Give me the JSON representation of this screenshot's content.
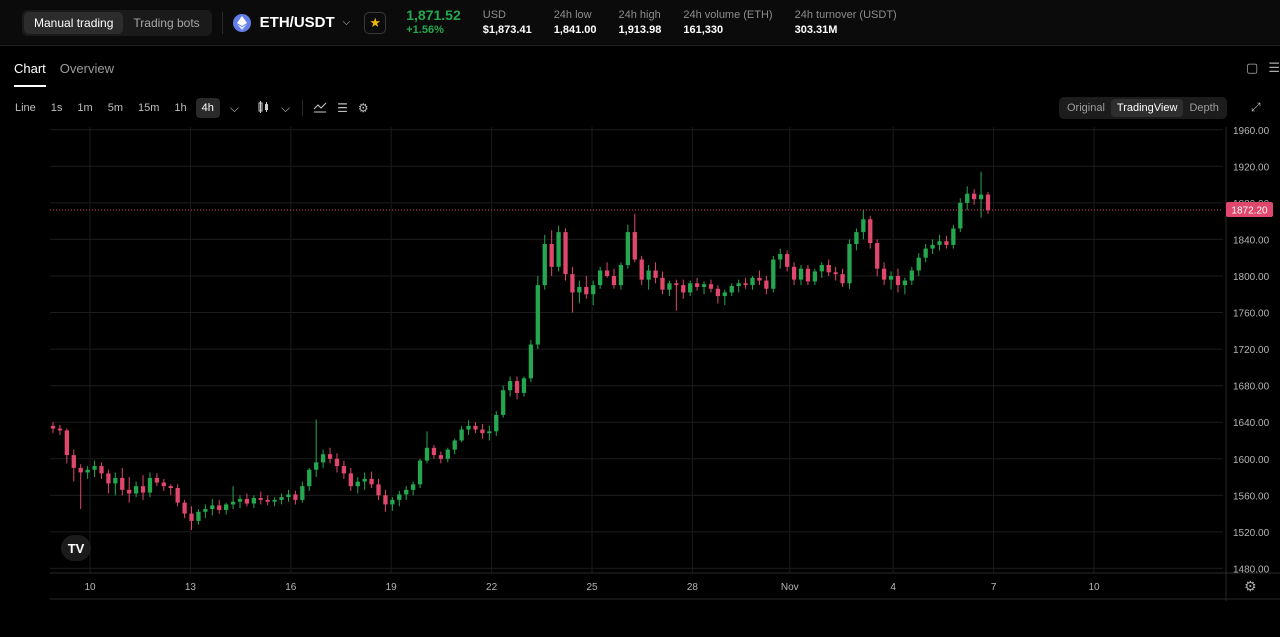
{
  "header": {
    "modes": [
      "Manual trading",
      "Trading bots"
    ],
    "pair": "ETH/USDT",
    "last_price": "1,871.52",
    "change": "+1.56%",
    "stats": [
      {
        "label": "USD",
        "value": "$1,873.41"
      },
      {
        "label": "24h low",
        "value": "1,841.00"
      },
      {
        "label": "24h high",
        "value": "1,913.98"
      },
      {
        "label": "24h volume (ETH)",
        "value": "161,330"
      },
      {
        "label": "24h turnover (USDT)",
        "value": "303.31M"
      }
    ]
  },
  "tabs": [
    "Chart",
    "Overview"
  ],
  "toolbar": {
    "timeframes": [
      "Line",
      "1s",
      "1m",
      "5m",
      "15m",
      "1h",
      "4h"
    ],
    "active_timeframe": "4h",
    "views": [
      "Original",
      "TradingView",
      "Depth"
    ],
    "active_view": "TradingView"
  },
  "colors": {
    "up": "#25a750",
    "down": "#e0476c",
    "price_line": "#e0476c"
  },
  "icons": [
    "ethereum-icon",
    "chevron-down-icon",
    "star-icon",
    "candles-icon",
    "indicator-icon",
    "layout-icon",
    "gear-icon",
    "expand-icon",
    "tradingview-logo"
  ],
  "chart_data": {
    "type": "candlestick",
    "y_ticks": [
      "1960.00",
      "1920.00",
      "1880.00",
      "1840.00",
      "1800.00",
      "1760.00",
      "1720.00",
      "1680.00",
      "1640.00",
      "1600.00",
      "1560.00",
      "1520.00",
      "1480.00"
    ],
    "x_ticks": [
      "10",
      "13",
      "16",
      "19",
      "22",
      "25",
      "28",
      "Nov",
      "4",
      "7",
      "10"
    ],
    "current_price_label": "1872.20",
    "current_price": 1872.2,
    "ylim": [
      1475,
      1963
    ],
    "grid": true,
    "series_ohlc": [
      [
        1636,
        1640,
        1628,
        1633
      ],
      [
        1633,
        1637,
        1626,
        1631
      ],
      [
        1631,
        1633,
        1595,
        1604
      ],
      [
        1604,
        1610,
        1575,
        1590
      ],
      [
        1590,
        1594,
        1545,
        1585
      ],
      [
        1585,
        1592,
        1578,
        1588
      ],
      [
        1588,
        1598,
        1580,
        1592
      ],
      [
        1592,
        1596,
        1578,
        1584
      ],
      [
        1584,
        1588,
        1562,
        1573
      ],
      [
        1573,
        1585,
        1560,
        1579
      ],
      [
        1579,
        1590,
        1560,
        1566
      ],
      [
        1566,
        1580,
        1552,
        1562
      ],
      [
        1562,
        1575,
        1558,
        1570
      ],
      [
        1570,
        1582,
        1555,
        1563
      ],
      [
        1563,
        1585,
        1558,
        1579
      ],
      [
        1579,
        1584,
        1570,
        1574
      ],
      [
        1574,
        1578,
        1565,
        1570
      ],
      [
        1570,
        1572,
        1560,
        1568
      ],
      [
        1568,
        1572,
        1548,
        1552
      ],
      [
        1552,
        1555,
        1535,
        1540
      ],
      [
        1540,
        1548,
        1522,
        1532
      ],
      [
        1532,
        1545,
        1528,
        1542
      ],
      [
        1542,
        1550,
        1535,
        1545
      ],
      [
        1545,
        1556,
        1538,
        1549
      ],
      [
        1549,
        1555,
        1540,
        1544
      ],
      [
        1544,
        1552,
        1539,
        1550
      ],
      [
        1550,
        1570,
        1545,
        1553
      ],
      [
        1553,
        1560,
        1546,
        1556
      ],
      [
        1556,
        1562,
        1548,
        1551
      ],
      [
        1551,
        1560,
        1546,
        1557
      ],
      [
        1557,
        1564,
        1550,
        1555
      ],
      [
        1555,
        1560,
        1549,
        1553
      ],
      [
        1553,
        1558,
        1548,
        1555
      ],
      [
        1555,
        1562,
        1550,
        1558
      ],
      [
        1558,
        1566,
        1553,
        1561
      ],
      [
        1561,
        1565,
        1550,
        1555
      ],
      [
        1555,
        1575,
        1552,
        1570
      ],
      [
        1570,
        1590,
        1565,
        1588
      ],
      [
        1588,
        1643,
        1580,
        1596
      ],
      [
        1596,
        1610,
        1590,
        1605
      ],
      [
        1605,
        1612,
        1595,
        1600
      ],
      [
        1600,
        1606,
        1585,
        1592
      ],
      [
        1592,
        1598,
        1578,
        1584
      ],
      [
        1584,
        1590,
        1565,
        1570
      ],
      [
        1570,
        1580,
        1562,
        1575
      ],
      [
        1575,
        1585,
        1566,
        1578
      ],
      [
        1578,
        1586,
        1568,
        1572
      ],
      [
        1572,
        1578,
        1555,
        1560
      ],
      [
        1560,
        1566,
        1542,
        1550
      ],
      [
        1550,
        1558,
        1543,
        1555
      ],
      [
        1555,
        1565,
        1548,
        1561
      ],
      [
        1561,
        1570,
        1555,
        1566
      ],
      [
        1566,
        1575,
        1560,
        1572
      ],
      [
        1572,
        1600,
        1568,
        1598
      ],
      [
        1598,
        1630,
        1595,
        1612
      ],
      [
        1612,
        1615,
        1600,
        1604
      ],
      [
        1604,
        1608,
        1595,
        1600
      ],
      [
        1600,
        1612,
        1596,
        1610
      ],
      [
        1610,
        1622,
        1605,
        1620
      ],
      [
        1620,
        1636,
        1618,
        1632
      ],
      [
        1632,
        1642,
        1626,
        1636
      ],
      [
        1636,
        1640,
        1628,
        1632
      ],
      [
        1632,
        1638,
        1622,
        1628
      ],
      [
        1628,
        1636,
        1620,
        1630
      ],
      [
        1630,
        1652,
        1625,
        1648
      ],
      [
        1648,
        1680,
        1645,
        1675
      ],
      [
        1675,
        1690,
        1668,
        1685
      ],
      [
        1685,
        1690,
        1665,
        1672
      ],
      [
        1672,
        1690,
        1668,
        1688
      ],
      [
        1688,
        1730,
        1684,
        1725
      ],
      [
        1725,
        1800,
        1720,
        1790
      ],
      [
        1790,
        1845,
        1785,
        1835
      ],
      [
        1835,
        1850,
        1800,
        1810
      ],
      [
        1810,
        1855,
        1805,
        1848
      ],
      [
        1848,
        1852,
        1795,
        1802
      ],
      [
        1802,
        1810,
        1760,
        1782
      ],
      [
        1782,
        1795,
        1770,
        1788
      ],
      [
        1788,
        1800,
        1775,
        1780
      ],
      [
        1780,
        1795,
        1768,
        1790
      ],
      [
        1790,
        1810,
        1786,
        1806
      ],
      [
        1806,
        1815,
        1798,
        1800
      ],
      [
        1800,
        1808,
        1786,
        1790
      ],
      [
        1790,
        1815,
        1785,
        1812
      ],
      [
        1812,
        1856,
        1808,
        1848
      ],
      [
        1848,
        1868,
        1815,
        1818
      ],
      [
        1818,
        1822,
        1790,
        1796
      ],
      [
        1796,
        1812,
        1785,
        1806
      ],
      [
        1806,
        1815,
        1792,
        1798
      ],
      [
        1798,
        1805,
        1780,
        1785
      ],
      [
        1785,
        1795,
        1778,
        1792
      ],
      [
        1792,
        1796,
        1762,
        1790
      ],
      [
        1790,
        1796,
        1775,
        1782
      ],
      [
        1782,
        1795,
        1778,
        1792
      ],
      [
        1792,
        1798,
        1784,
        1788
      ],
      [
        1788,
        1794,
        1780,
        1791
      ],
      [
        1791,
        1796,
        1782,
        1786
      ],
      [
        1786,
        1790,
        1770,
        1778
      ],
      [
        1778,
        1785,
        1768,
        1782
      ],
      [
        1782,
        1792,
        1778,
        1789
      ],
      [
        1789,
        1796,
        1782,
        1792
      ],
      [
        1792,
        1798,
        1786,
        1790
      ],
      [
        1790,
        1800,
        1785,
        1798
      ],
      [
        1798,
        1806,
        1790,
        1795
      ],
      [
        1795,
        1800,
        1780,
        1786
      ],
      [
        1786,
        1822,
        1782,
        1818
      ],
      [
        1818,
        1830,
        1808,
        1824
      ],
      [
        1824,
        1828,
        1805,
        1810
      ],
      [
        1810,
        1815,
        1790,
        1796
      ],
      [
        1796,
        1812,
        1790,
        1808
      ],
      [
        1808,
        1812,
        1790,
        1794
      ],
      [
        1794,
        1808,
        1790,
        1805
      ],
      [
        1805,
        1815,
        1798,
        1812
      ],
      [
        1812,
        1818,
        1800,
        1804
      ],
      [
        1804,
        1810,
        1795,
        1802
      ],
      [
        1802,
        1808,
        1788,
        1792
      ],
      [
        1792,
        1840,
        1786,
        1835
      ],
      [
        1835,
        1852,
        1828,
        1848
      ],
      [
        1848,
        1872,
        1840,
        1862
      ],
      [
        1862,
        1866,
        1830,
        1836
      ],
      [
        1836,
        1840,
        1800,
        1808
      ],
      [
        1808,
        1815,
        1790,
        1796
      ],
      [
        1796,
        1805,
        1785,
        1800
      ],
      [
        1800,
        1808,
        1782,
        1790
      ],
      [
        1790,
        1798,
        1780,
        1795
      ],
      [
        1795,
        1810,
        1790,
        1806
      ],
      [
        1806,
        1825,
        1800,
        1820
      ],
      [
        1820,
        1835,
        1815,
        1830
      ],
      [
        1830,
        1840,
        1824,
        1834
      ],
      [
        1834,
        1845,
        1828,
        1838
      ],
      [
        1838,
        1844,
        1830,
        1834
      ],
      [
        1834,
        1856,
        1830,
        1852
      ],
      [
        1852,
        1885,
        1848,
        1880
      ],
      [
        1880,
        1898,
        1872,
        1890
      ],
      [
        1890,
        1895,
        1878,
        1884
      ],
      [
        1884,
        1914,
        1864,
        1889
      ],
      [
        1889,
        1892,
        1868,
        1872
      ]
    ]
  }
}
